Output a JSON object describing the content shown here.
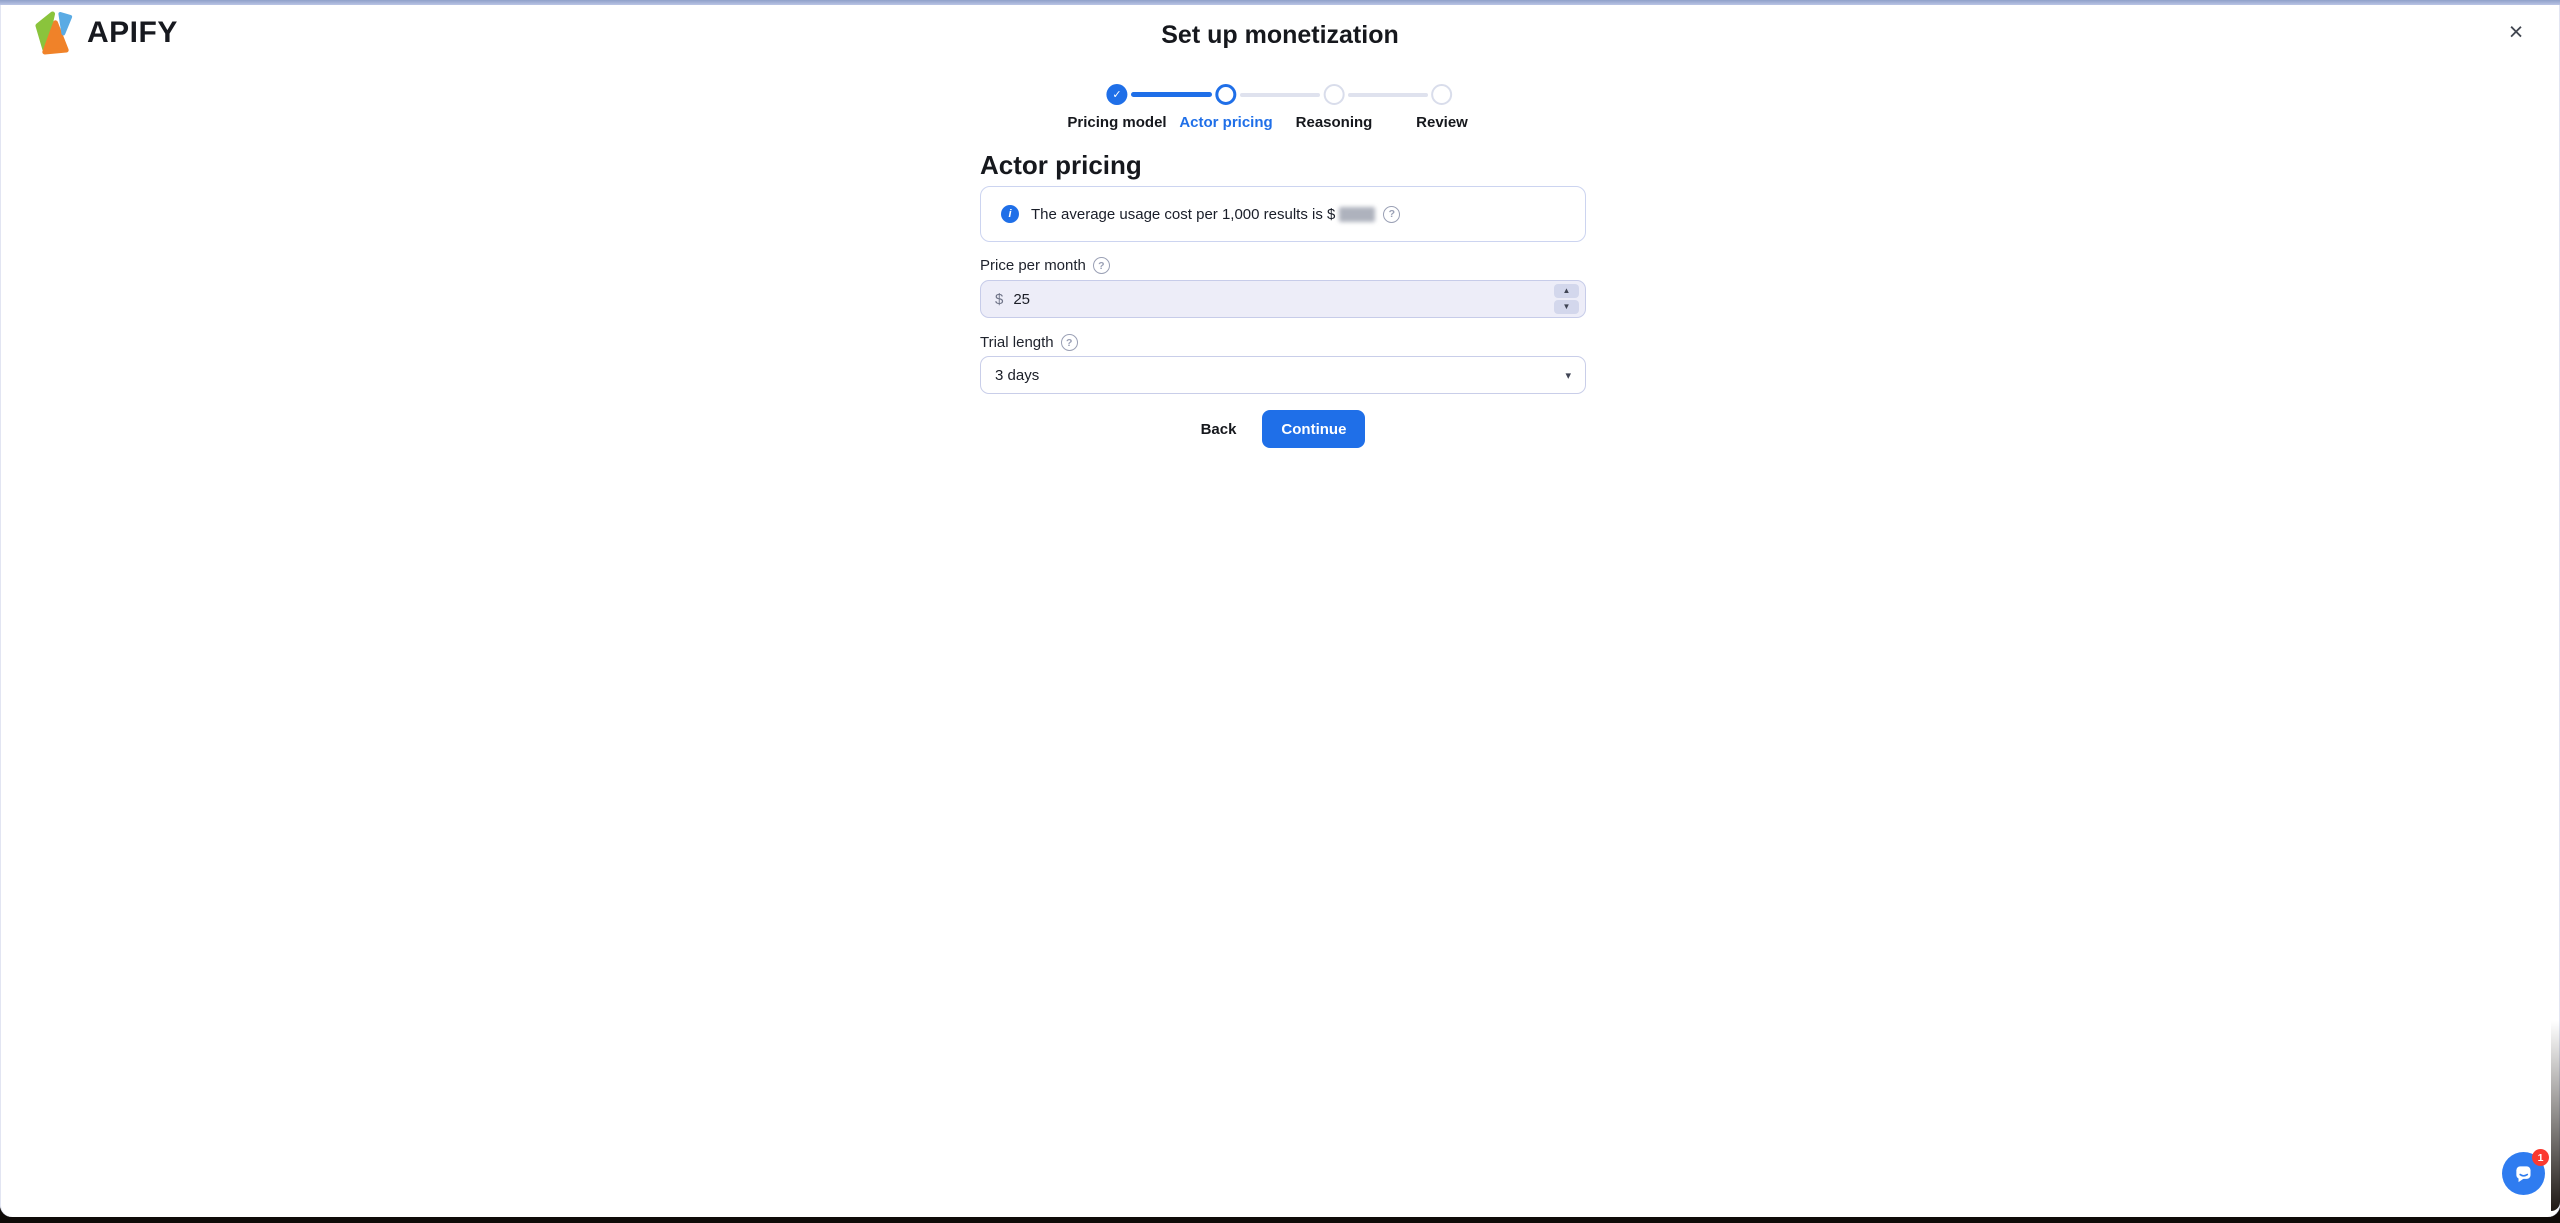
{
  "colors": {
    "accent": "#1f6fe8",
    "chat_blue": "#2f7cf0",
    "logo_green": "#8ac43c",
    "logo_orange": "#f08229",
    "logo_blue": "#5aabe4"
  },
  "icons": {
    "close": "×",
    "check": "✓",
    "info": "i",
    "help": "?",
    "caret_down": "▾",
    "spin_up": "▲",
    "spin_down": "▼"
  },
  "brand": {
    "name": "APIFY"
  },
  "modal": {
    "title": "Set up monetization"
  },
  "stepper": {
    "steps": [
      {
        "label": "Pricing model",
        "state": "done"
      },
      {
        "label": "Actor pricing",
        "state": "active"
      },
      {
        "label": "Reasoning",
        "state": "todo"
      },
      {
        "label": "Review",
        "state": "todo"
      }
    ]
  },
  "form": {
    "heading": "Actor pricing",
    "banner": {
      "text": "The average usage cost per 1,000 results is $",
      "value_redacted": true
    },
    "price": {
      "label": "Price per month",
      "currency": "$",
      "value": "25"
    },
    "trial": {
      "label": "Trial length",
      "selected": "3 days"
    },
    "back_label": "Back",
    "continue_label": "Continue"
  },
  "chat": {
    "badge_count": "1"
  }
}
